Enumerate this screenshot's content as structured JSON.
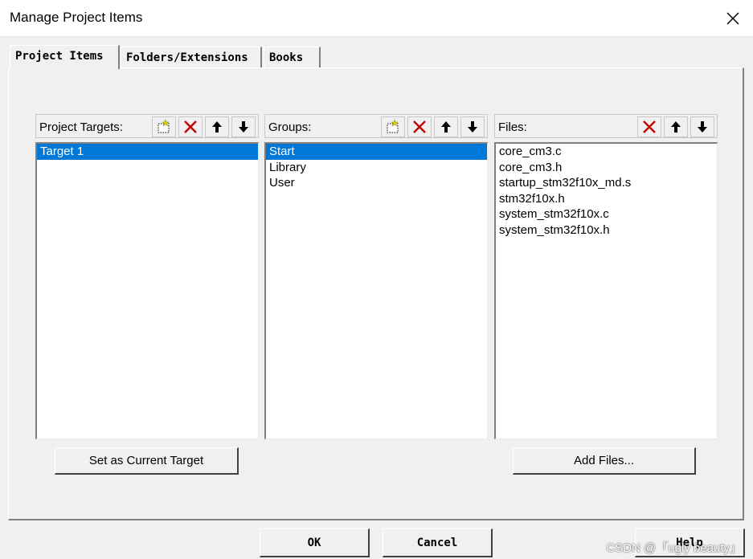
{
  "window": {
    "title": "Manage Project Items"
  },
  "tabs": [
    {
      "label": "Project Items",
      "active": true
    },
    {
      "label": "Folders/Extensions",
      "active": false
    },
    {
      "label": "Books",
      "active": false
    }
  ],
  "targets": {
    "label": "Project Targets:",
    "items": [
      "Target 1"
    ],
    "selected_index": 0
  },
  "groups": {
    "label": "Groups:",
    "items": [
      "Start",
      "Library",
      "User"
    ],
    "selected_index": 0
  },
  "files": {
    "label": "Files:",
    "items": [
      "core_cm3.c",
      "core_cm3.h",
      "startup_stm32f10x_md.s",
      "stm32f10x.h",
      "system_stm32f10x.c",
      "system_stm32f10x.h"
    ]
  },
  "buttons": {
    "set_current_target": "Set as Current Target",
    "add_files": "Add Files...",
    "ok": "OK",
    "cancel": "Cancel",
    "help": "Help"
  },
  "watermark": "CSDN @「ugly beauty」",
  "icons": {
    "new": "new-item-icon",
    "delete": "delete-x-icon",
    "up": "arrow-up-icon",
    "down": "arrow-down-icon",
    "close": "close-icon"
  },
  "colors": {
    "selection": "#0078d7",
    "delete_red": "#c00000"
  }
}
